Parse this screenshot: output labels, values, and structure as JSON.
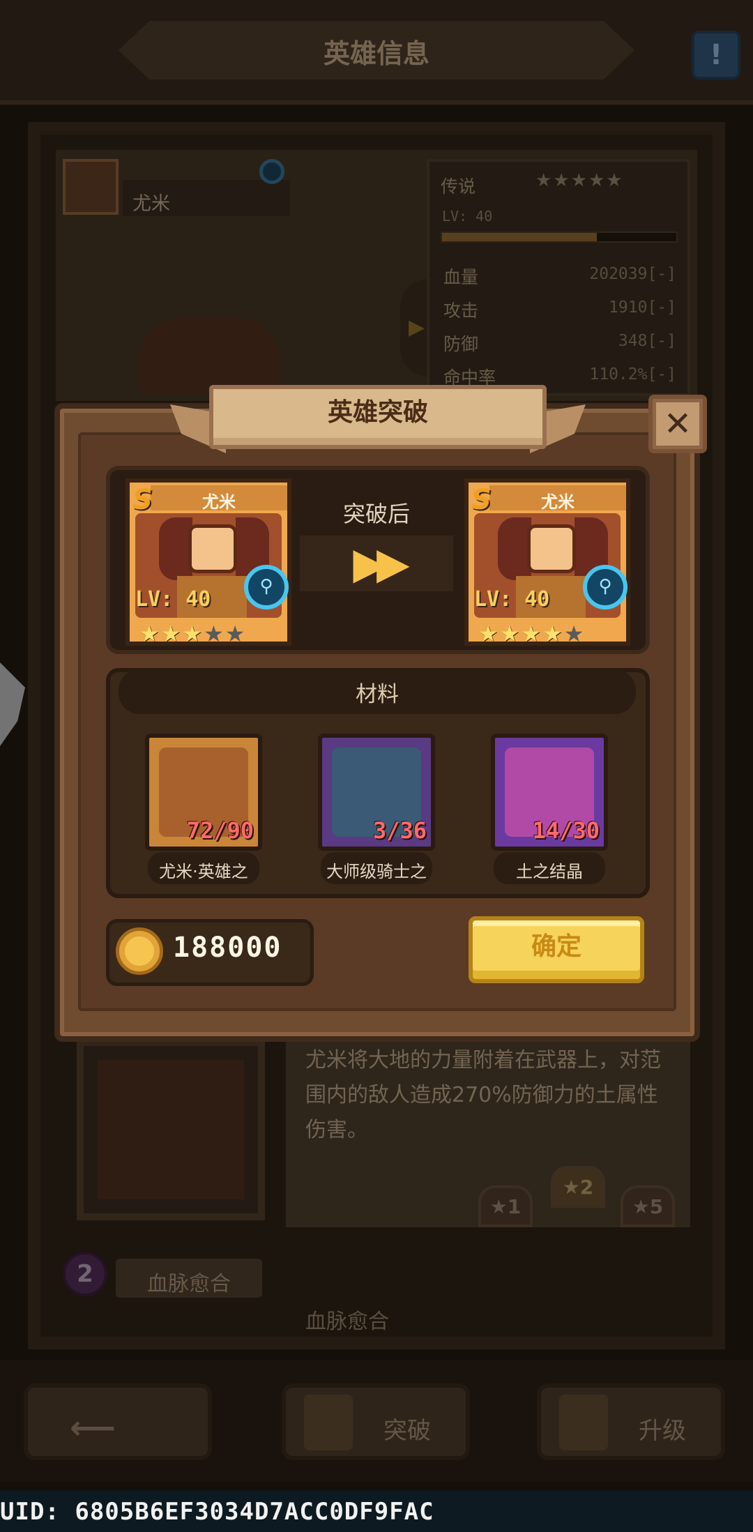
{
  "page": {
    "title": "英雄信息"
  },
  "hero": {
    "name": "尤米",
    "rarity": "传说",
    "stars_filled": 3,
    "stars_total": 5,
    "level_text": "LV: 40",
    "exp_fraction": 0.66,
    "stats": [
      {
        "label": "血量",
        "value": "202039[-]"
      },
      {
        "label": "攻击",
        "value": "1910[-]"
      },
      {
        "label": "防御",
        "value": "348[-]"
      },
      {
        "label": "命中率",
        "value": "110.2%[-]"
      }
    ]
  },
  "skill": {
    "description": "尤米将大地的力量附着在武器上，对范围内的敌人造成270%防御力的土属性伤害。",
    "tiers": [
      "★1",
      "★2",
      "★5"
    ],
    "skill2_number": "2",
    "skill2_name": "血脉愈合",
    "skill2_sub": "血脉愈合"
  },
  "bottom_nav": {
    "breakthrough_label": "突破",
    "upgrade_label": "升级"
  },
  "uid_text": "UID: 6805B6EF3034D7ACC0DF9FAC",
  "modal": {
    "title": "英雄突破",
    "after_label": "突破后",
    "before_card": {
      "rank": "S",
      "name": "尤米",
      "level": "LV: 40",
      "stars_filled": 3,
      "stars_total": 5
    },
    "after_card": {
      "rank": "S",
      "name": "尤米",
      "level": "LV: 40",
      "stars_filled": 4,
      "stars_total": 5
    },
    "materials_title": "材料",
    "materials": [
      {
        "name": "尤米·英雄之",
        "count": "72/90",
        "color": "#c98638",
        "icon": "hero-soul-icon"
      },
      {
        "name": "大师级骑士之",
        "count": "3/36",
        "color": "#5a3a82",
        "icon": "knight-emblem-icon"
      },
      {
        "name": "土之结晶",
        "count": "14/30",
        "color": "#6a3aa0",
        "icon": "earth-crystal-icon"
      }
    ],
    "gold_cost": "188000",
    "confirm_label": "确定"
  }
}
